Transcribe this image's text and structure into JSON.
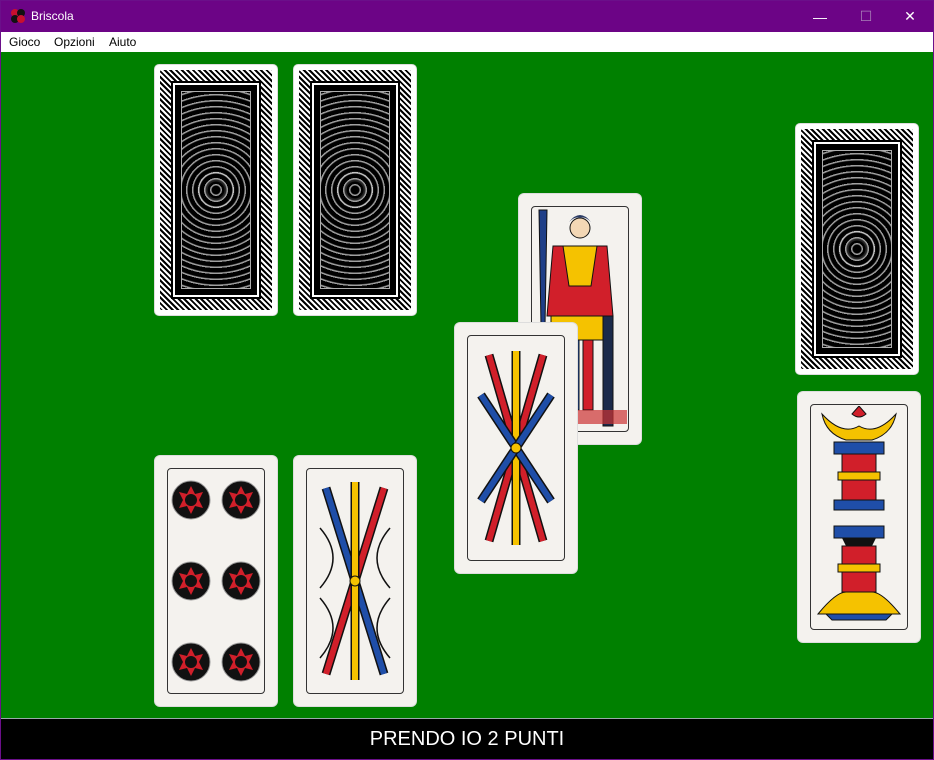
{
  "window": {
    "title": "Briscola",
    "minimize": "—",
    "maximize": "☐",
    "close": "✕"
  },
  "menu": {
    "items": [
      "Gioco",
      "Opzioni",
      "Aiuto"
    ]
  },
  "cards": {
    "opponent_1": "covered card",
    "opponent_2": "covered card",
    "deck": "deck",
    "played_top": "Fante di Spade",
    "played_bottom": "5 di Bastoni",
    "briscola": "Coppe",
    "hand_1": "6 di Denari",
    "hand_2": "4 di Bastoni"
  },
  "status": {
    "message": "PRENDO IO 2 PUNTI"
  },
  "colors": {
    "title_bar": "#6c0486",
    "table": "#008000",
    "status_bar": "#000000"
  }
}
